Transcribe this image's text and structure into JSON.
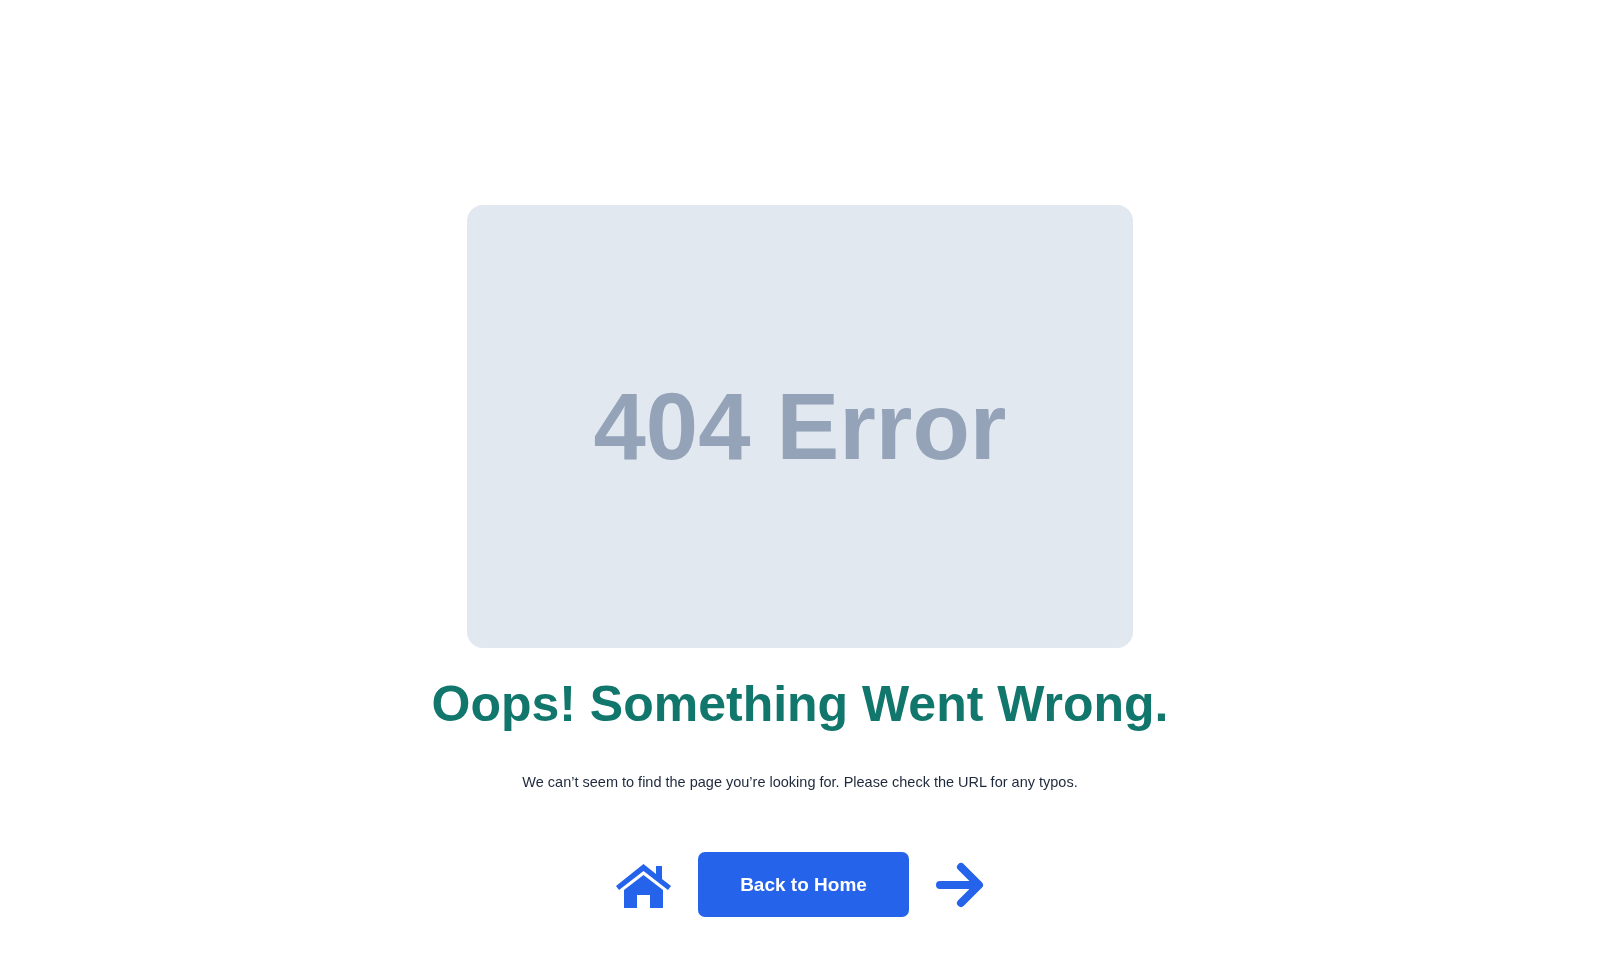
{
  "placeholder_card": {
    "text": "404 Error"
  },
  "heading": "Oops! Something Went Wrong.",
  "message": "We can’t seem to find the page you’re looking for. Please check the URL for any typos.",
  "actions": {
    "button": "Back to Home"
  }
}
